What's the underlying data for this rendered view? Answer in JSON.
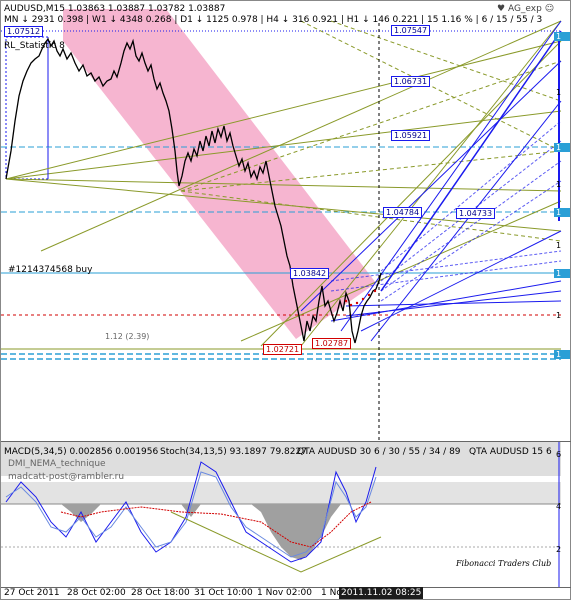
{
  "main_header": {
    "line1": "AUDUSD,M15  1.03863 1.03887 1.03782 1.03887",
    "line2": "MN ↓ 2931  0.398 | W1 ↓ 4348  0.268 | D1 ↓ 1125  0.978 | H4 ↓ 316  0.921 | H1 ↓ 146  0.221 | 15  1.16 % | 6 / 15 / 55 / 3",
    "indicator": "RL_Statistic 8",
    "expert": "AG_exp"
  },
  "levels": {
    "l1": "1.07512",
    "l2": "1.07547",
    "l3": "1.06731",
    "l4": "1.05921",
    "l5": "1.04784",
    "l6": "1.04733",
    "l7": "1.03842",
    "l8": "1.02721",
    "l9": "1.02787"
  },
  "order_label": "#1214374568 buy",
  "ratio_label": "1.12 (2.39)",
  "watermark": "Fibonacci Traders Club",
  "sub_header": {
    "macd": "MACD(5,34,5)  0.002856  0.001956",
    "stoch": "Stoch(34,13,5)  93.1897  79.8227",
    "qta1": "QTA AUDUSD 30  6 / 30 / 55 / 34 / 89",
    "qta2": "QTA AUDUSD 15  6",
    "line2": "DMI_NEMA_technique",
    "line3": "madcatt-post@rambler.ru"
  },
  "right_axis": {
    "a1": "1",
    "a2": "1",
    "a3": "1",
    "a4": "1",
    "a5": "1",
    "a6": "1",
    "a7": "1",
    "a8": "1",
    "a9": "1",
    "s1": "6",
    "s2": "4",
    "s3": "2"
  },
  "x_axis": {
    "t1": "27 Oct 2011",
    "t2": "28 Oct 02:00",
    "t3": "28 Oct 18:00",
    "t4": "31 Oct 10:00",
    "t5": "1 Nov 02:00",
    "t6": "1 No",
    "current_time": "2011.11.02 08:25"
  },
  "colors": {
    "channel": "#f5a8c8",
    "price": "#000000",
    "fib_level": "#1a1aee",
    "grid_cyan": "#2a9fd6",
    "olive": "#8a9a2a",
    "hist": "#a0a0a0"
  }
}
